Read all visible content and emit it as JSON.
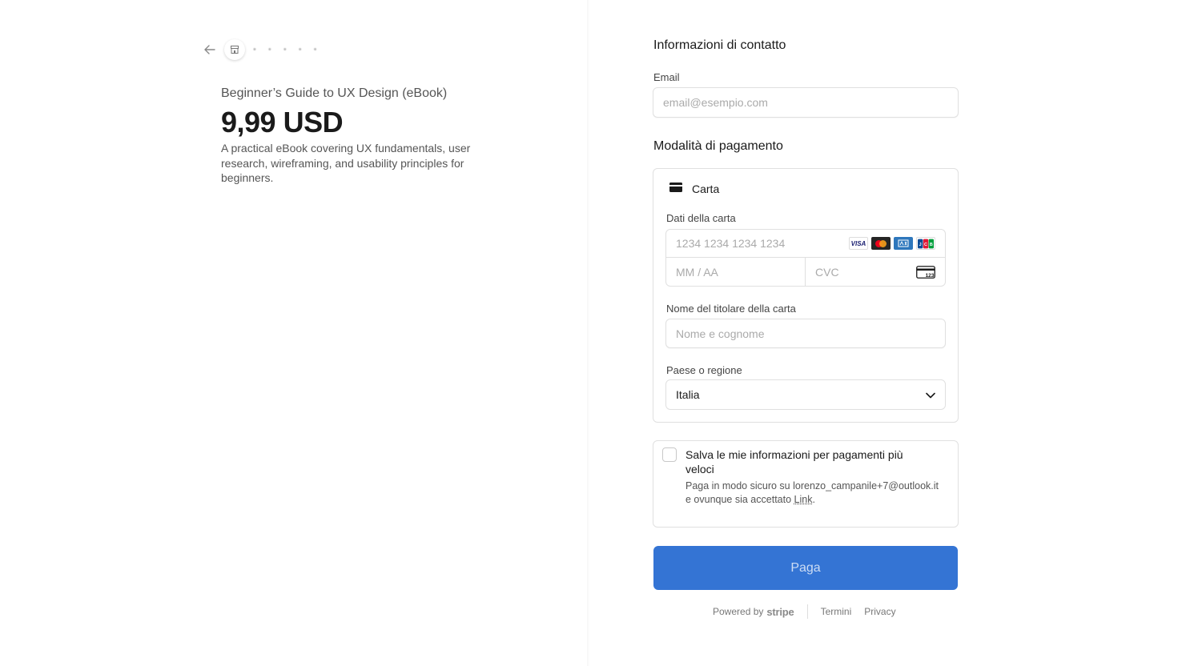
{
  "merchant": {
    "name_masked": "• • • • •"
  },
  "product": {
    "name": "Beginner’s Guide to UX Design (eBook)",
    "price": "9,99 USD",
    "description": "A practical eBook covering UX fundamentals, user research, wireframing, and usability principles for beginners."
  },
  "contact": {
    "title": "Informazioni di contatto",
    "email_label": "Email",
    "email_placeholder": "email@esempio.com"
  },
  "payment": {
    "title": "Modalità di pagamento",
    "method_label": "Carta",
    "card_data_label": "Dati della carta",
    "card_number_placeholder": "1234 1234 1234 1234",
    "expiry_placeholder": "MM / AA",
    "cvc_placeholder": "CVC",
    "brands": [
      "VISA",
      "MC",
      "AMEX",
      "JCB"
    ],
    "cardholder_label": "Nome del titolare della carta",
    "cardholder_placeholder": "Nome e cognome",
    "country_label": "Paese o regione",
    "country_value": "Italia"
  },
  "save_info": {
    "title": "Salva le mie informazioni per pagamenti più veloci",
    "desc_prefix": "Paga in modo sicuro su lorenzo_campanile+7@outlook.it e ovunque sia accettato ",
    "desc_link": "Link",
    "desc_suffix": "."
  },
  "pay_button_label": "Paga",
  "footer": {
    "powered_by": "Powered by",
    "stripe": "stripe",
    "terms": "Termini",
    "privacy": "Privacy"
  },
  "colors": {
    "accent": "#3474d4",
    "border": "#e0e0e0"
  }
}
